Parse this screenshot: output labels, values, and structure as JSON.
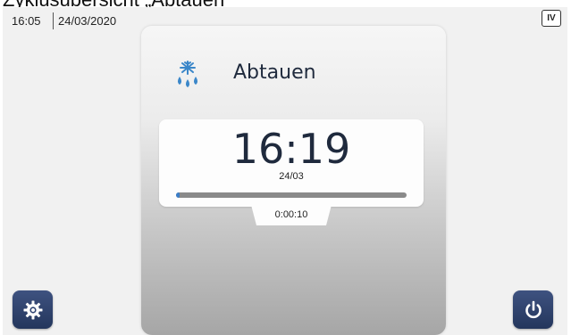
{
  "heading": "Zyklusübersicht „Abtauen“",
  "status_bar": {
    "time": "16:05",
    "date": "24/03/2020",
    "level_badge": "IV"
  },
  "mode": {
    "label": "Abtauen",
    "icon": "snowflake-drops-icon"
  },
  "card": {
    "end_time": "16:19",
    "end_date": "24/03",
    "progress": 0.01
  },
  "elapsed": "0:00:10",
  "buttons": {
    "settings_icon": "gear-icon",
    "power_icon": "power-icon"
  },
  "colors": {
    "accent_blue": "#2e4372",
    "icon_blue": "#3b87c9",
    "progress_fill": "#3b7ec9"
  }
}
